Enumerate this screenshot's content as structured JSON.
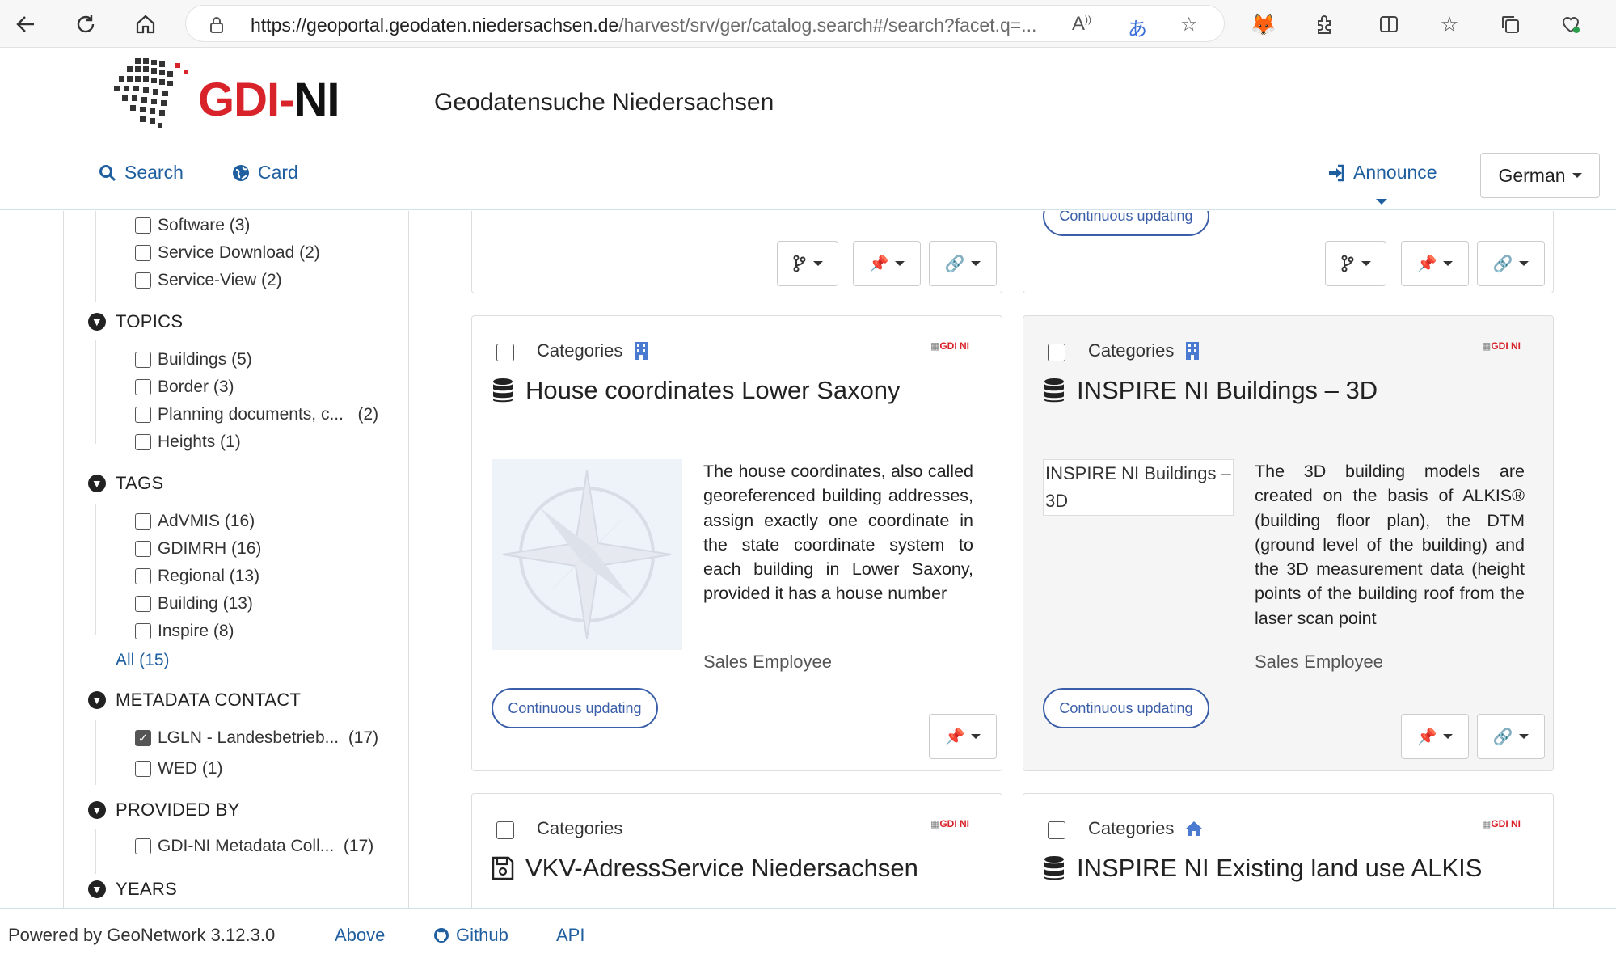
{
  "browser": {
    "url_host": "https://geoportal.geodaten.niedersachsen.de",
    "url_path": "/harvest/srv/ger/catalog.search#/search?facet.q=..."
  },
  "header": {
    "logo_gdi": "GDI",
    "logo_dash": "-",
    "logo_ni": "NI",
    "site_title": "Geodatensuche Niedersachsen",
    "nav_search": "Search",
    "nav_card": "Card",
    "announce": "Announce",
    "language": "German"
  },
  "sidebar": {
    "type_items": [
      {
        "label": "Software",
        "count": "(3)"
      },
      {
        "label": "Service Download",
        "count": "(2)"
      },
      {
        "label": "Service-View",
        "count": "(2)"
      }
    ],
    "topics": {
      "heading": "TOPICS",
      "items": [
        {
          "label": "Buildings",
          "count": "(5)"
        },
        {
          "label": "Border",
          "count": "(3)"
        },
        {
          "label": "Planning documents, c...",
          "count": "(2)"
        },
        {
          "label": "Heights",
          "count": "(1)"
        }
      ]
    },
    "tags": {
      "heading": "TAGS",
      "items": [
        {
          "label": "AdVMIS",
          "count": "(16)"
        },
        {
          "label": "GDIMRH",
          "count": "(16)"
        },
        {
          "label": "Regional",
          "count": "(13)"
        },
        {
          "label": "Building",
          "count": "(13)"
        },
        {
          "label": "Inspire",
          "count": "(8)"
        }
      ],
      "all_link": "All (15)"
    },
    "metadata_contact": {
      "heading": "METADATA CONTACT",
      "items": [
        {
          "label": "LGLN - Landesbetrieb...",
          "count": "(17)",
          "checked": true
        },
        {
          "label": "WED",
          "count": "(1)",
          "checked": false
        }
      ]
    },
    "provided_by": {
      "heading": "PROVIDED BY",
      "items": [
        {
          "label": "GDI-NI Metadata Coll...",
          "count": "(17)"
        }
      ]
    },
    "years": {
      "heading": "YEARS"
    }
  },
  "cards": {
    "top_right_pill": "Continuous updating",
    "card1": {
      "category": "Categories",
      "title": "House coordinates Lower Saxony",
      "description": "The house coordinates, also called georeferenced building addresses, assign exactly one coordinate in the state coordinate system to each building in Lower Saxony, provided it has a house number",
      "owner": "Sales Employee",
      "status": "Continuous updating"
    },
    "card2": {
      "category": "Categories",
      "title": "INSPIRE NI Buildings – 3D",
      "thumb_alt": "INSPIRE NI Buildings – 3D",
      "description": "The 3D building models are created on the basis of ALKIS® (building floor plan), the DTM (ground level of the building) and the 3D measurement data (height points of the building roof from the laser scan point",
      "owner": "Sales Employee",
      "status": "Continuous updating"
    },
    "card3": {
      "category": "Categories",
      "title": "VKV-AdressService Niedersachsen"
    },
    "card4": {
      "category": "Categories",
      "title": "INSPIRE NI Existing land use ALKIS"
    },
    "minilogo": "GDI NI"
  },
  "footer": {
    "powered": "Powered by GeoNetwork 3.12.3.0",
    "above": "Above",
    "github": "Github",
    "api": "API"
  }
}
